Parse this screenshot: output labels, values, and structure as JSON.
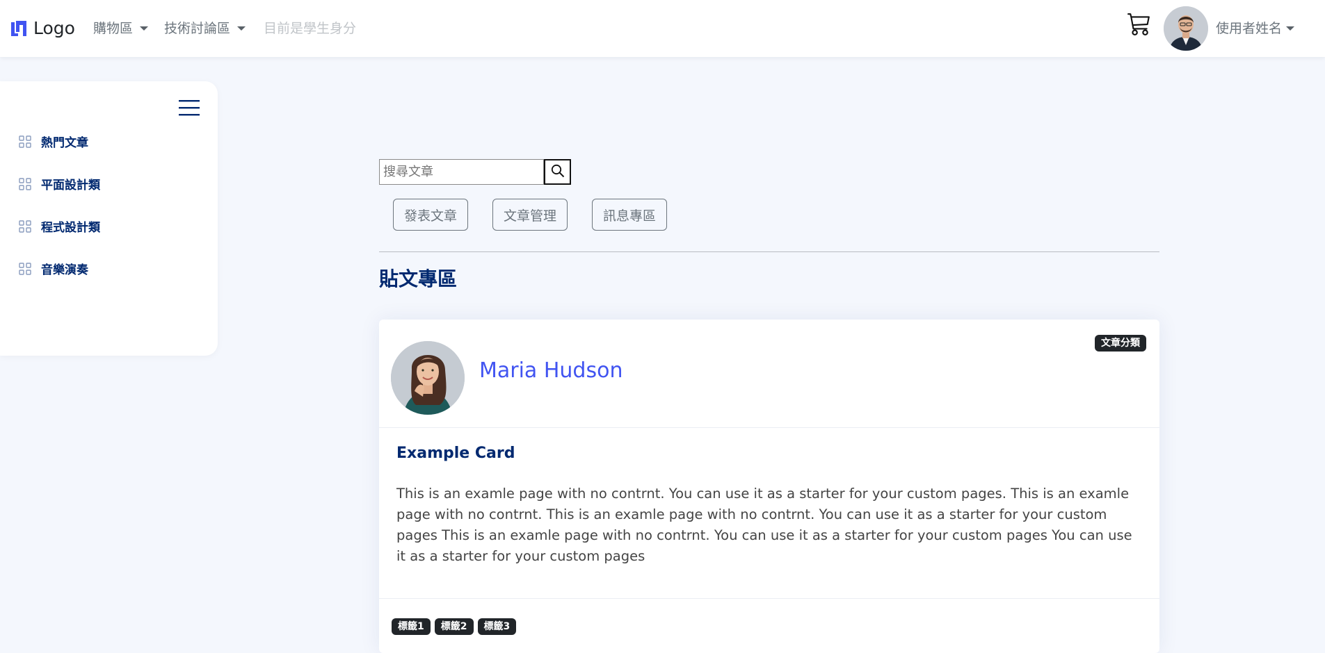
{
  "navbar": {
    "logo_text": "Logo",
    "menu_shop": "購物區",
    "menu_tech": "技術討論區",
    "status_text": "目前是學生身分",
    "user_name": "使用者姓名",
    "icons": [
      "logo-icon",
      "cart-icon",
      "avatar"
    ]
  },
  "sidebar": {
    "toggle_icon": "hamburger-icon",
    "items": [
      {
        "label": "熱門文章",
        "icon": "grid-icon"
      },
      {
        "label": "平面設計類",
        "icon": "grid-icon"
      },
      {
        "label": "程式設計類",
        "icon": "grid-icon"
      },
      {
        "label": "音樂演奏",
        "icon": "grid-icon"
      }
    ]
  },
  "search": {
    "placeholder": "搜尋文章",
    "value": ""
  },
  "actions": {
    "post": "發表文章",
    "manage": "文章管理",
    "messages": "訊息專區"
  },
  "section_title": "貼文專區",
  "card": {
    "author": "Maria Hudson",
    "category_badge": "文章分類",
    "title": "Example Card",
    "text": "This is an examle page with no contrnt. You can use it as a starter for your custom pages. This is an examle page with no contrnt. This is an examle page with no contrnt. You can use it as a starter for your custom pages This is an examle page with no contrnt. You can use it as a starter for your custom pages You can use it as a starter for your custom pages",
    "tags": [
      "標籤1",
      "標籤2",
      "標籤3"
    ]
  },
  "colors": {
    "brand": "#4154f1",
    "navy": "#012970",
    "background": "#f4f7fd",
    "badge": "#212529"
  }
}
